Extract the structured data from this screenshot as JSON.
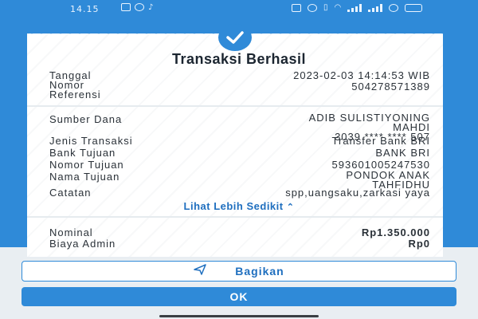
{
  "status_bar": {
    "time": "14.15"
  },
  "receipt": {
    "title": "Transaksi Berhasil",
    "rows": [
      {
        "label": "Tanggal",
        "value": "2023-02-03 14:14:53 WIB"
      },
      {
        "label_line1": "Nomor",
        "label_line2": "Referensi",
        "value": "504278571389"
      },
      {
        "label": "Sumber Dana",
        "value_line1": "ADIB SULISTIYONING",
        "value_line2": "MAHDI",
        "value_line3": "3039 **** **** 507"
      },
      {
        "label": "Jenis Transaksi",
        "value": "Transfer Bank BRI"
      },
      {
        "label": "Bank Tujuan",
        "value": "BANK BRI"
      },
      {
        "label": "Nomor Tujuan",
        "value": "593601005247530"
      },
      {
        "label": "Nama Tujuan",
        "value_line1": "PONDOK ANAK",
        "value_line2": "TAHFIDHU"
      },
      {
        "label": "Catatan",
        "value": "spp,uangsaku,zarkasi yaya"
      }
    ],
    "show_less": "Lihat Lebih Sedikit",
    "nominal_label": "Nominal",
    "nominal_value": "Rp1.350.000",
    "admin_label": "Biaya Admin",
    "admin_value": "Rp0"
  },
  "actions": {
    "share_label": "Bagikan",
    "ok_label": "OK"
  },
  "colors": {
    "primary": "#2f8ad8",
    "link": "#1f6fbf",
    "text": "#2a3138"
  }
}
